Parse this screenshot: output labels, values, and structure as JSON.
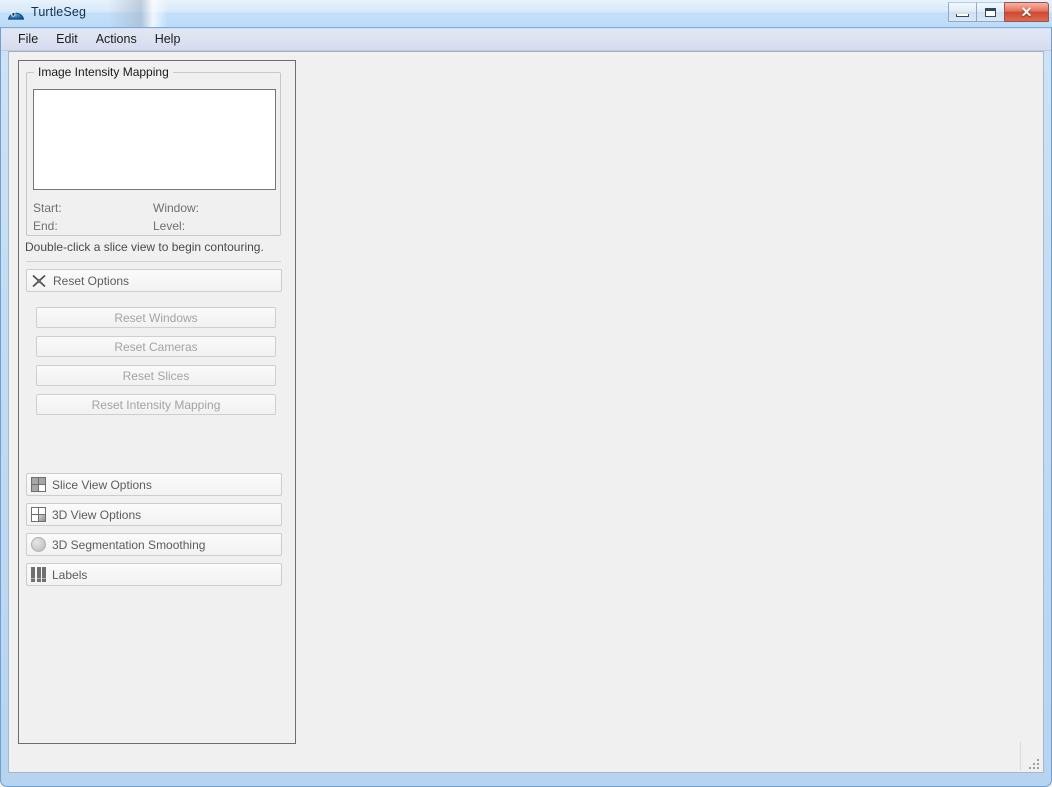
{
  "window": {
    "title": "TurtleSeg",
    "icon": "turtle-shell-icon",
    "controls": {
      "minimize_label": "",
      "maximize_label": "",
      "close_label": "✕"
    }
  },
  "menubar": {
    "items": [
      {
        "label": "File"
      },
      {
        "label": "Edit"
      },
      {
        "label": "Actions"
      },
      {
        "label": "Help"
      }
    ]
  },
  "left_panel": {
    "intensity_group": {
      "title": "Image Intensity Mapping",
      "stats": [
        {
          "label": "Start:",
          "value": ""
        },
        {
          "label": "Window:",
          "value": ""
        },
        {
          "label": "End:",
          "value": ""
        },
        {
          "label": "Level:",
          "value": ""
        }
      ]
    },
    "hint": "Double-click a slice view to begin contouring.",
    "reset_section": {
      "header_label": "Reset Options",
      "header_icon": "reset-cross-icon",
      "buttons": [
        {
          "label": "Reset Windows"
        },
        {
          "label": "Reset Cameras"
        },
        {
          "label": "Reset Slices"
        },
        {
          "label": "Reset Intensity Mapping"
        }
      ]
    },
    "sections": [
      {
        "label": "Slice View Options",
        "icon": "quad-view-icon"
      },
      {
        "label": "3D View Options",
        "icon": "quad-3d-view-icon"
      },
      {
        "label": "3D Segmentation Smoothing",
        "icon": "sphere-icon"
      },
      {
        "label": "Labels",
        "icon": "labels-bars-icon"
      }
    ]
  },
  "colors": {
    "titlebar_start": "#e8f2fc",
    "titlebar_end": "#bcdcf8",
    "menubar": "#dde2f1",
    "client_bg": "#f0f0f0",
    "close_button": "#cd4731",
    "panel_border": "#6d6d6d",
    "disabled_text": "#a3a3a3",
    "label_text": "#707070"
  }
}
